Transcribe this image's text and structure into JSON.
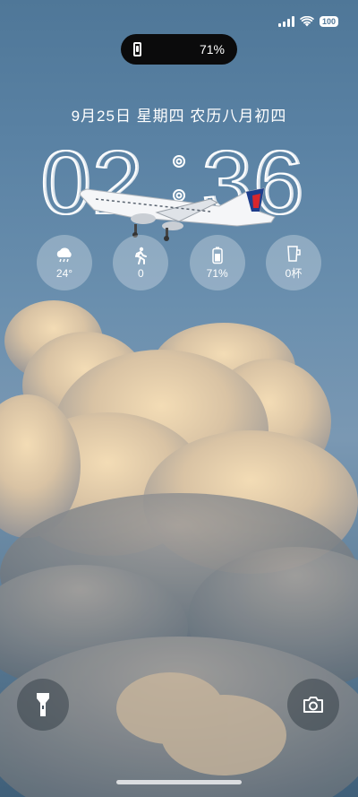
{
  "status": {
    "battery_badge": "100"
  },
  "island": {
    "battery_percent": "71%"
  },
  "lockscreen": {
    "date": "9月25日 星期四 农历八月初四",
    "time_hours": "02",
    "time_minutes": "36"
  },
  "widgets": [
    {
      "icon": "weather-rain-icon",
      "value": "24°"
    },
    {
      "icon": "walking-icon",
      "value": "0"
    },
    {
      "icon": "battery-icon",
      "value": "71%"
    },
    {
      "icon": "water-cup-icon",
      "value": "0杯"
    }
  ],
  "shortcuts": {
    "left": "flashlight-icon",
    "right": "camera-icon"
  }
}
